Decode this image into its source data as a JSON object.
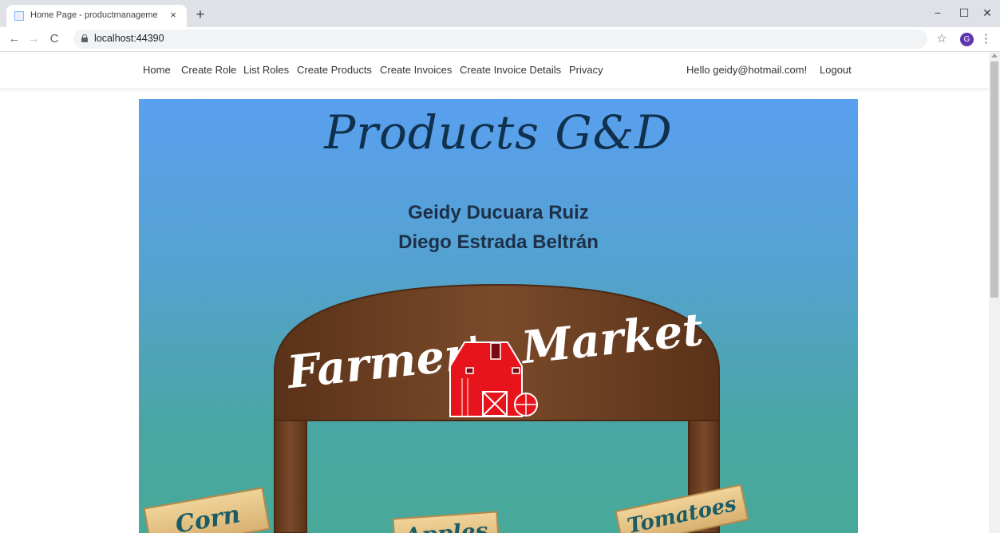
{
  "browser": {
    "tab_title": "Home Page - productmanageme",
    "tab_close": "×",
    "new_tab": "+",
    "url": "localhost:44390",
    "avatar_letter": "G",
    "window_controls": [
      "−",
      "☐",
      "✕"
    ]
  },
  "navbar": {
    "links": [
      "Home",
      "Create Role",
      "List Roles",
      "Create Products",
      "Create Invoices",
      "Create Invoice Details",
      "Privacy"
    ],
    "greeting": "Hello geidy@hotmail.com!",
    "logout": "Logout"
  },
  "hero": {
    "title": "Products G&D",
    "authors": [
      "Geidy Ducuara Ruiz",
      "Diego Estrada Beltrán"
    ],
    "sign_text": "Farmer's Market",
    "crates": [
      "Corn",
      "Apples",
      "Tomatoes"
    ]
  },
  "colors": {
    "hero_top": "#5aa0f0",
    "hero_bottom": "#48a999",
    "wood": "#6b3f22",
    "barn_red": "#e8141c",
    "crate": "#e6c48a"
  }
}
